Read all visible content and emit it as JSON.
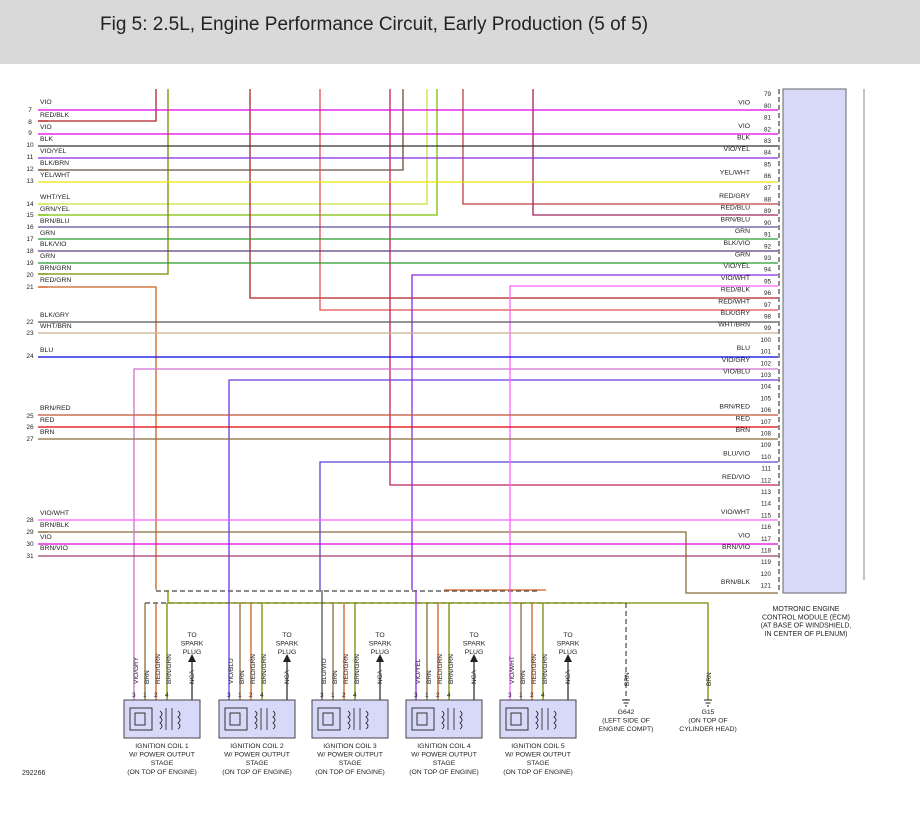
{
  "header": {
    "title": "Fig 5: 2.5L, Engine Performance Circuit, Early Production (5 of 5)"
  },
  "figure_id": "292266",
  "colors": {
    "VIO": "#e000e0",
    "RED/BLK": "#b22222",
    "BLK": "#333333",
    "VIO/YEL": "#8a2be2",
    "BLK/BRN": "#6b4f3a",
    "YEL/WHT": "#e6e600",
    "WHT/YEL": "#c8e040",
    "GRN/YEL": "#7ac000",
    "BRN/BLU": "#5a4fa0",
    "GRN": "#2a9a2a",
    "BLK/VIO": "#5a3a7a",
    "BRN/GRN": "#7a8a00",
    "RED/GRN": "#cc6020",
    "BLK/GRY": "#555555",
    "WHT/BRN": "#c8b090",
    "BLU": "#0000e0",
    "VIO/GRY": "#d070d0",
    "VIO/BLU": "#6a3ae0",
    "BRN/RED": "#c05030",
    "RED": "#e00000",
    "BRN": "#8b6b3a",
    "VIO/WHT": "#ff60ff",
    "BRN/BLK": "#8b6b3a",
    "BRN/VIO": "#a03a6a",
    "RED/GRY": "#c04040",
    "RED/BLU": "#a0205a",
    "RED/WHT": "#e05050",
    "ecm_fill": "#d8d8f8"
  },
  "left_pins": [
    {
      "num": "7",
      "label": "VIO"
    },
    {
      "num": "8",
      "label": "RED/BLK"
    },
    {
      "num": "9",
      "label": "VIO"
    },
    {
      "num": "10",
      "label": "BLK"
    },
    {
      "num": "11",
      "label": "VIO/YEL"
    },
    {
      "num": "12",
      "label": "BLK/BRN"
    },
    {
      "num": "13",
      "label": "YEL/WHT"
    },
    {
      "num": "14",
      "label": "WHT/YEL"
    },
    {
      "num": "15",
      "label": "GRN/YEL"
    },
    {
      "num": "16",
      "label": "BRN/BLU"
    },
    {
      "num": "17",
      "label": "GRN"
    },
    {
      "num": "18",
      "label": "BLK/VIO"
    },
    {
      "num": "19",
      "label": "GRN"
    },
    {
      "num": "20",
      "label": "BRN/GRN"
    },
    {
      "num": "21",
      "label": "RED/GRN"
    },
    {
      "num": "22",
      "label": "BLK/GRY"
    },
    {
      "num": "23",
      "label": "WHT/BRN"
    },
    {
      "num": "24",
      "label": "BLU"
    },
    {
      "num": "25",
      "label": "BRN/RED"
    },
    {
      "num": "26",
      "label": "RED"
    },
    {
      "num": "27",
      "label": "BRN"
    },
    {
      "num": "28",
      "label": "VIO/WHT"
    },
    {
      "num": "29",
      "label": "BRN/BLK"
    },
    {
      "num": "30",
      "label": "VIO"
    },
    {
      "num": "31",
      "label": "BRN/VIO"
    }
  ],
  "right_pins": [
    {
      "num": "79",
      "label": ""
    },
    {
      "num": "80",
      "label": "VIO"
    },
    {
      "num": "81",
      "label": ""
    },
    {
      "num": "82",
      "label": "VIO"
    },
    {
      "num": "83",
      "label": "BLK"
    },
    {
      "num": "84",
      "label": "VIO/YEL"
    },
    {
      "num": "85",
      "label": ""
    },
    {
      "num": "86",
      "label": "YEL/WHT"
    },
    {
      "num": "87",
      "label": ""
    },
    {
      "num": "88",
      "label": "RED/GRY"
    },
    {
      "num": "89",
      "label": "RED/BLU"
    },
    {
      "num": "90",
      "label": "BRN/BLU"
    },
    {
      "num": "91",
      "label": "GRN"
    },
    {
      "num": "92",
      "label": "BLK/VIO"
    },
    {
      "num": "93",
      "label": "GRN"
    },
    {
      "num": "94",
      "label": "VIO/YEL"
    },
    {
      "num": "95",
      "label": "VIO/WHT"
    },
    {
      "num": "96",
      "label": "RED/BLK"
    },
    {
      "num": "97",
      "label": "RED/WHT"
    },
    {
      "num": "98",
      "label": "BLK/GRY"
    },
    {
      "num": "99",
      "label": "WHT/BRN"
    },
    {
      "num": "100",
      "label": ""
    },
    {
      "num": "101",
      "label": "BLU"
    },
    {
      "num": "102",
      "label": "VIO/GRY"
    },
    {
      "num": "103",
      "label": "VIO/BLU"
    },
    {
      "num": "104",
      "label": ""
    },
    {
      "num": "105",
      "label": ""
    },
    {
      "num": "106",
      "label": "BRN/RED"
    },
    {
      "num": "107",
      "label": "RED"
    },
    {
      "num": "108",
      "label": "BRN"
    },
    {
      "num": "109",
      "label": ""
    },
    {
      "num": "110",
      "label": "BLU/VIO"
    },
    {
      "num": "111",
      "label": ""
    },
    {
      "num": "112",
      "label": "RED/VIO"
    },
    {
      "num": "113",
      "label": ""
    },
    {
      "num": "114",
      "label": ""
    },
    {
      "num": "115",
      "label": "VIO/WHT"
    },
    {
      "num": "116",
      "label": ""
    },
    {
      "num": "117",
      "label": "VIO"
    },
    {
      "num": "118",
      "label": "BRN/VIO"
    },
    {
      "num": "119",
      "label": ""
    },
    {
      "num": "120",
      "label": ""
    },
    {
      "num": "121",
      "label": "BRN/BLK"
    }
  ],
  "ecm_label": [
    "MOTRONIC ENGINE",
    "CONTROL MODULE (ECM)",
    "(AT BASE OF WINDSHIELD,",
    "IN CENTER OF PLENUM)"
  ],
  "coils": [
    {
      "wires": [
        "VIO/GRY",
        "BRN",
        "RED/GRN",
        "BRN/GRN",
        "NCA"
      ],
      "name": [
        "IGNITION COIL 1",
        "W/ POWER OUTPUT",
        "STAGE",
        "(ON TOP OF ENGINE)"
      ]
    },
    {
      "wires": [
        "VIO/BLU",
        "BRN",
        "RED/GRN",
        "BRN/GRN",
        "NCA"
      ],
      "name": [
        "IGNITION COIL 2",
        "W/ POWER OUTPUT",
        "STAGE",
        "(ON TOP OF ENGINE)"
      ]
    },
    {
      "wires": [
        "BLU/VIO",
        "BRN",
        "RED/GRN",
        "BRN/GRN",
        "NCA"
      ],
      "name": [
        "IGNITION COIL 3",
        "W/ POWER OUTPUT",
        "STAGE",
        "(ON TOP OF ENGINE)"
      ]
    },
    {
      "wires": [
        "VIO/YEL",
        "BRN",
        "RED/GRN",
        "BRN/GRN",
        "NCA"
      ],
      "name": [
        "IGNITION COIL 4",
        "W/ POWER OUTPUT",
        "STAGE",
        "(ON TOP OF ENGINE)"
      ]
    },
    {
      "wires": [
        "VIO/WHT",
        "BRN",
        "RED/GRN",
        "BRN/GRN",
        "NCA"
      ],
      "name": [
        "IGNITION COIL 5",
        "W/ POWER OUTPUT",
        "STAGE",
        "(ON TOP OF ENGINE)"
      ]
    }
  ],
  "coil_pin_nums": [
    "3",
    "1",
    "2",
    "4"
  ],
  "spark_plug": [
    "TO",
    "SPARK",
    "PLUG"
  ],
  "grounds": [
    {
      "wire": "BRN",
      "name": [
        "G642",
        "(LEFT SIDE OF",
        "ENGINE COMPT)"
      ]
    },
    {
      "wire": "BRN",
      "name": [
        "G15",
        "(ON TOP OF",
        "CYLINDER HEAD)"
      ]
    }
  ]
}
